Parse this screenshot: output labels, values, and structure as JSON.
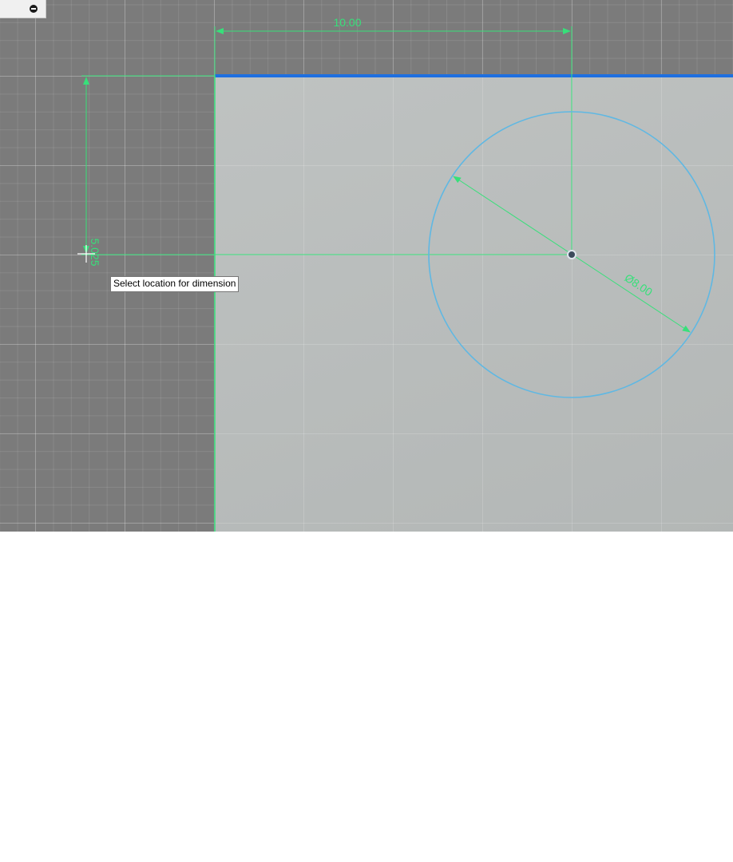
{
  "window": {
    "collapse_icon": "minus-circle-icon"
  },
  "sketch": {
    "dimensions": {
      "horizontal": "10.00",
      "vertical": "5.025",
      "diameter": "Ø8.00"
    },
    "colors": {
      "dimension": "#37e07a",
      "circle": "#5fb8e3",
      "selected_edge": "#1e6fe0",
      "center_point": "#3c4a5c"
    }
  },
  "status": {
    "tooltip": "Select location for dimension"
  }
}
